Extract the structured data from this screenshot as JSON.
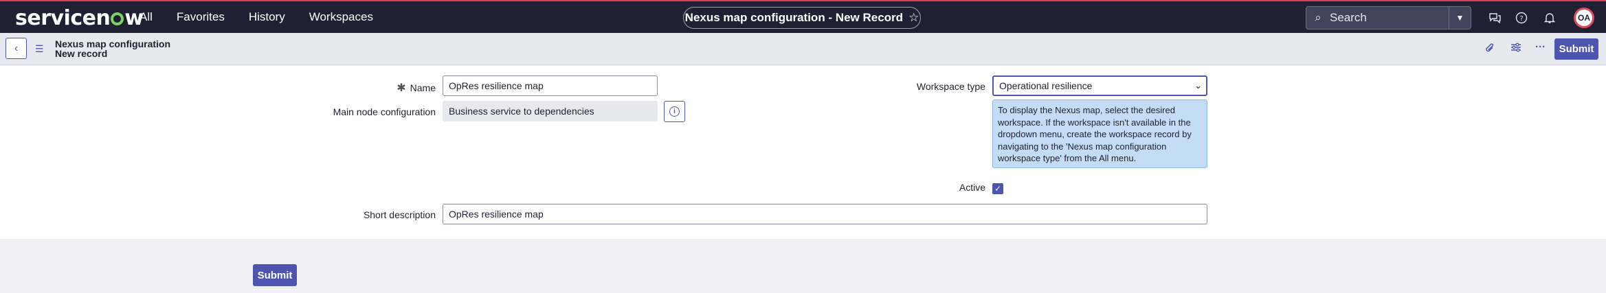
{
  "nav": {
    "logo_pre": "servicen",
    "logo_post": "w",
    "links": [
      "All",
      "Favorites",
      "History",
      "Workspaces"
    ],
    "record_title": "Nexus map configuration - New Record",
    "search_placeholder": "Search",
    "avatar_initials": "OA"
  },
  "header": {
    "title_line1": "Nexus map configuration",
    "title_line2": "New record",
    "submit_label": "Submit"
  },
  "form": {
    "name_label": "Name",
    "name_value": "OpRes resilience map",
    "main_node_label": "Main node configuration",
    "main_node_value": "Business service to dependencies",
    "workspace_type_label": "Workspace type",
    "workspace_type_value": "Operational resilience",
    "workspace_help": "To display the Nexus map, select the desired workspace. If the workspace isn't available in the dropdown menu, create the workspace record by navigating to the 'Nexus map configuration workspace type' from the All menu.",
    "active_label": "Active",
    "active_checked": true,
    "short_desc_label": "Short description",
    "short_desc_value": "OpRes resilience map"
  },
  "footer": {
    "submit_label": "Submit"
  },
  "colors": {
    "primary": "#4d55b0",
    "nav_bg": "#1f2132",
    "help_bg": "#c4dcf5",
    "logo_accent": "#7dd35c"
  }
}
